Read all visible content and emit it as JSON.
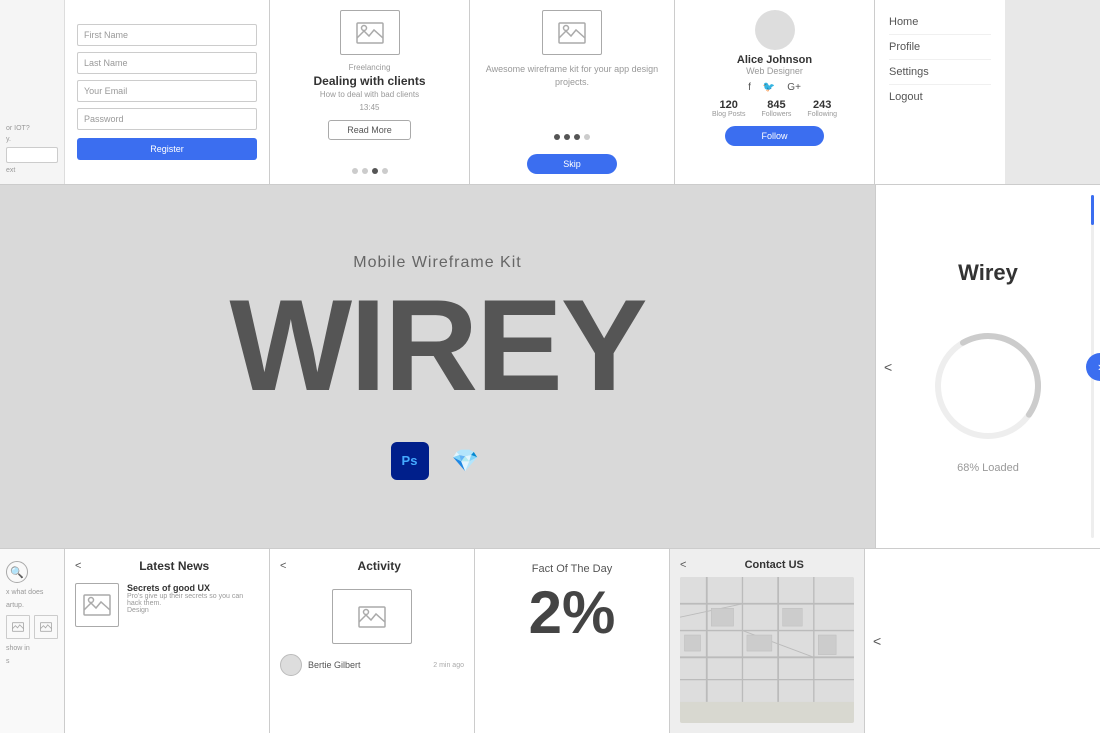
{
  "topRow": {
    "regForm": {
      "fields": [
        "First Name",
        "Last Name",
        "Your Email",
        "Password"
      ],
      "button": "Register"
    },
    "blog": {
      "tag": "Freelancing",
      "title": "Dealing with clients",
      "subtitle": "How to deal with bad clients",
      "time": "13:45",
      "button": "Read More",
      "dots": [
        false,
        false,
        false,
        true
      ]
    },
    "onboard": {
      "text": "Awesome wireframe kit for your app design projects.",
      "button": "Skip",
      "dots": [
        true,
        true,
        true,
        false
      ]
    },
    "profile": {
      "name": "Alice Johnson",
      "role": "Web Designer",
      "stats": [
        {
          "num": "120",
          "label": "Blog Posts"
        },
        {
          "num": "845",
          "label": "Followers"
        },
        {
          "num": "243",
          "label": "Following"
        }
      ],
      "button": "Follow"
    },
    "menu": {
      "items": [
        "Home",
        "Profile",
        "Settings",
        "Logout"
      ]
    }
  },
  "hero": {
    "subtitle": "Mobile Wireframe Kit",
    "title": "WIREY"
  },
  "loading": {
    "title": "Wirey",
    "percent": "68% Loaded"
  },
  "bottomRow": {
    "news": {
      "title": "Latest News",
      "item": {
        "title": "Secrets of good UX",
        "subtitle": "Pro's give up their secrets so you can hack them.",
        "tag": "Design"
      }
    },
    "activity": {
      "title": "Activity",
      "user": "Bertie Gilbert",
      "time": "2 min ago"
    },
    "fact": {
      "label": "Fact Of The Day",
      "number": "2%"
    },
    "map": {
      "title": "Contact US"
    }
  }
}
